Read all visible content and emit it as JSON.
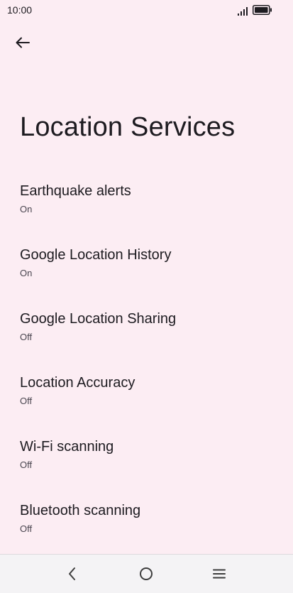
{
  "status_bar": {
    "time": "10:00"
  },
  "header": {
    "back_icon": "arrow-back-icon",
    "title": "Location Services"
  },
  "settings": [
    {
      "title": "Earthquake alerts",
      "summary": "On"
    },
    {
      "title": "Google Location History",
      "summary": "On"
    },
    {
      "title": "Google Location Sharing",
      "summary": "Off"
    },
    {
      "title": "Location Accuracy",
      "summary": "Off"
    },
    {
      "title": "Wi-Fi scanning",
      "summary": "Off"
    },
    {
      "title": "Bluetooth scanning",
      "summary": "Off"
    }
  ],
  "nav_bar": {
    "back_icon": "chevron-left-icon",
    "home_icon": "circle-home-icon",
    "recents_icon": "menu-lines-icon"
  },
  "colors": {
    "background": "#fcedf3",
    "text_primary": "#1d1b20",
    "text_secondary": "#49454f",
    "nav_background": "#f4f3f5"
  }
}
